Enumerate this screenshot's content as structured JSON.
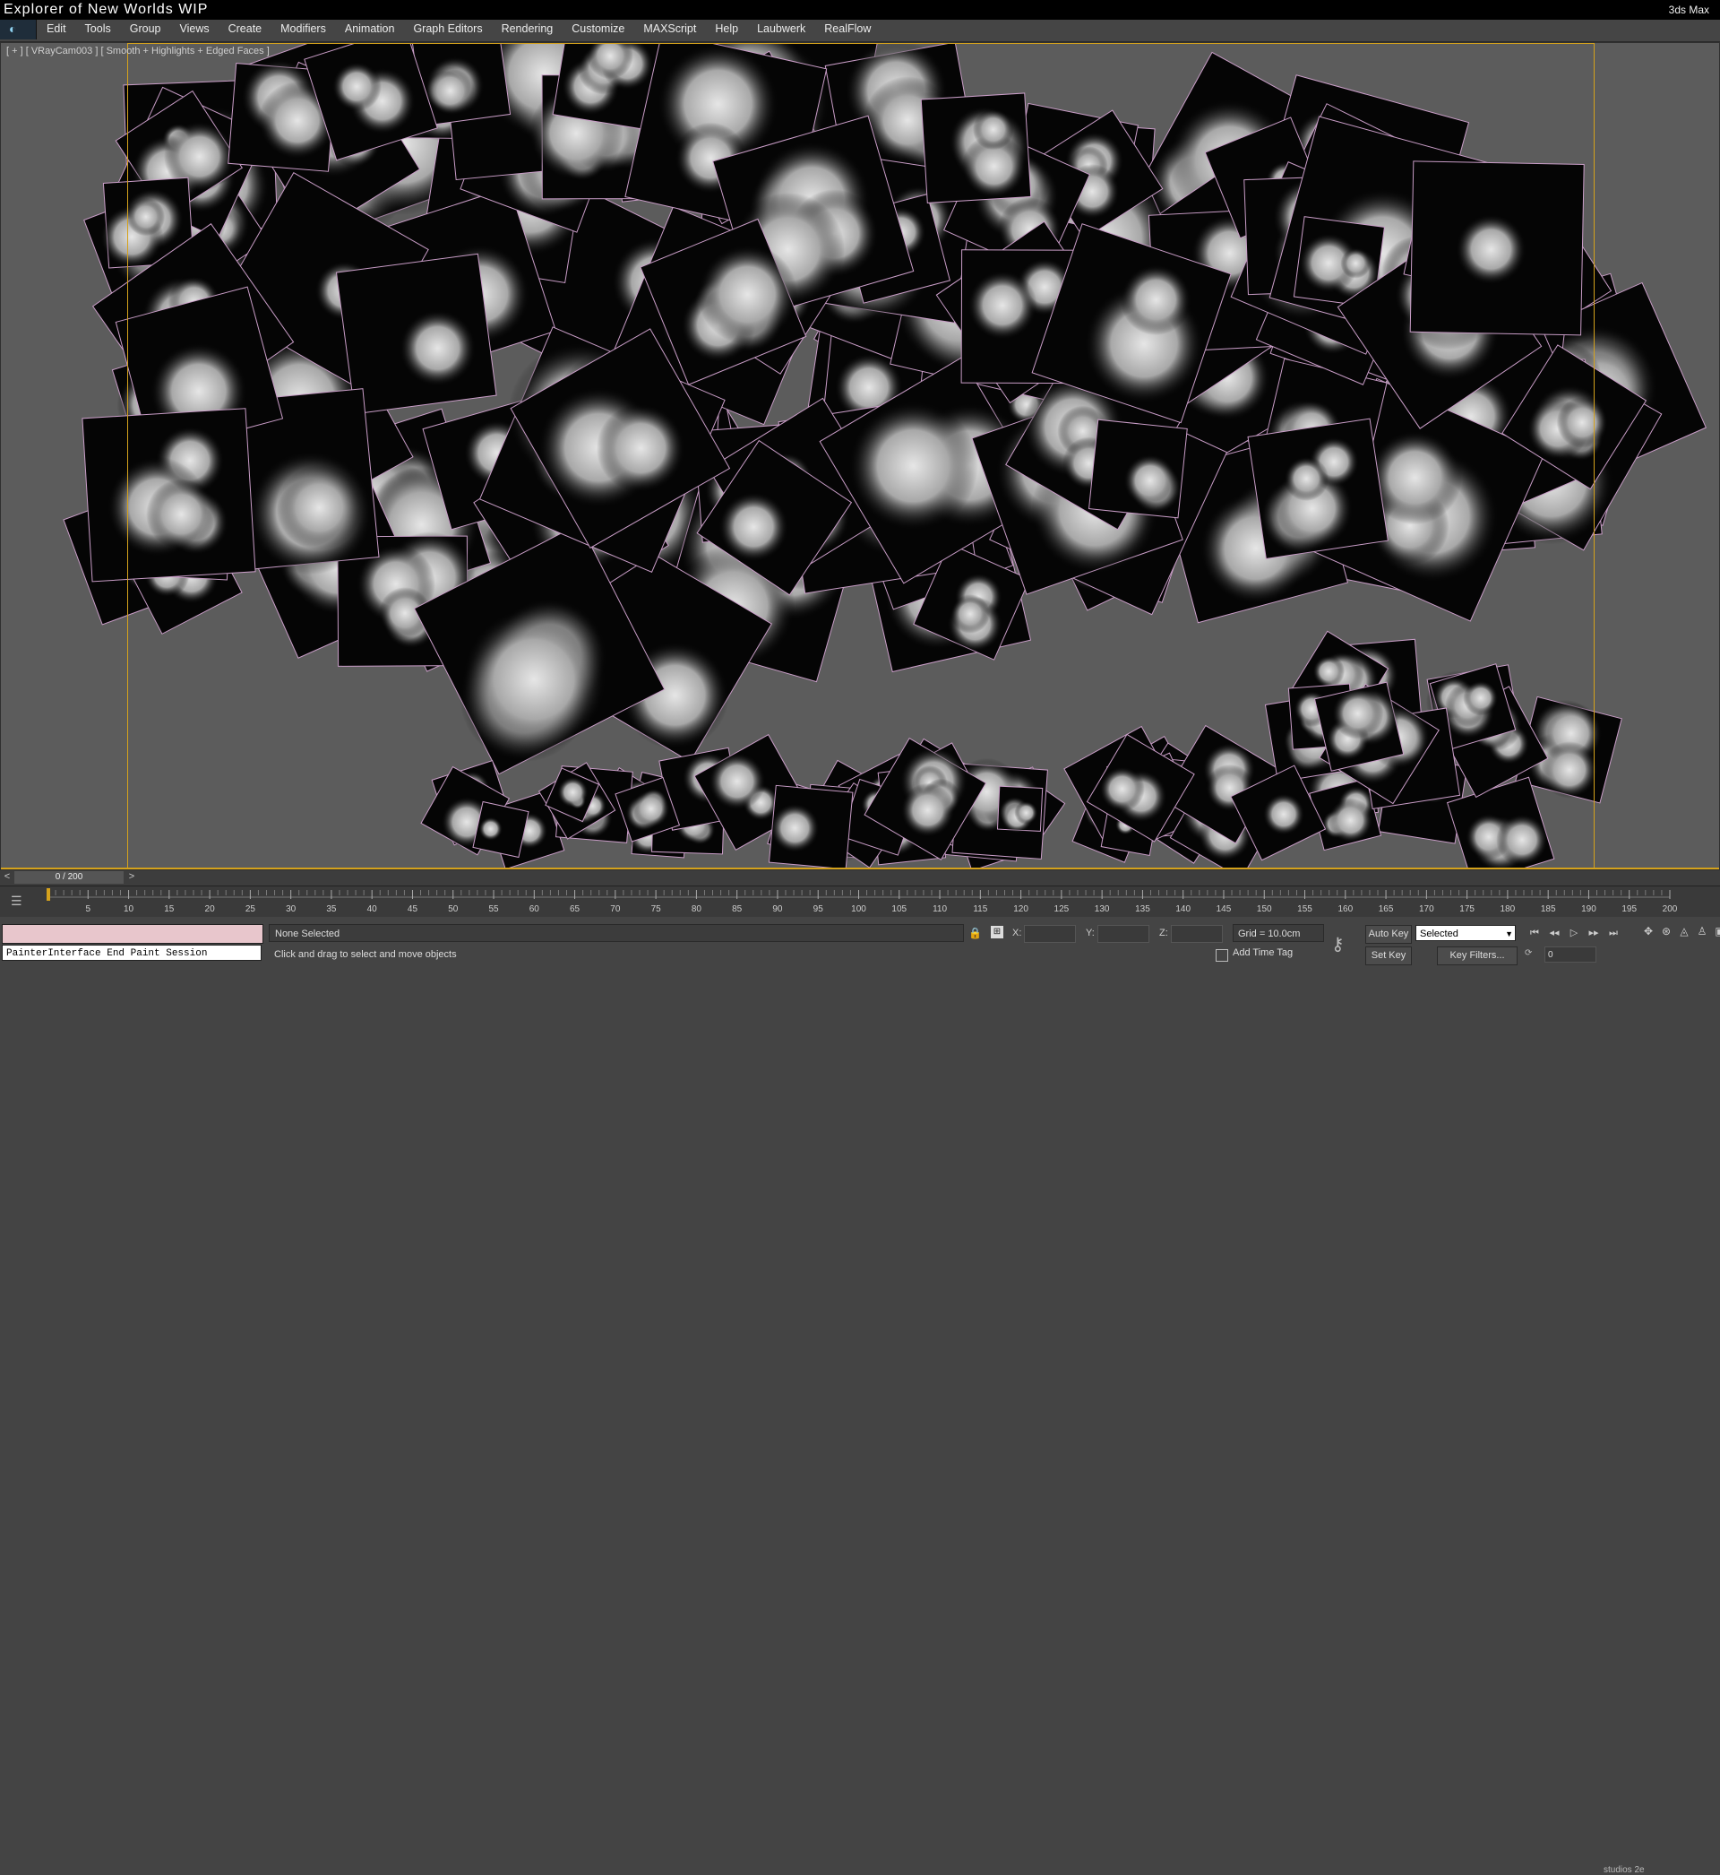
{
  "window": {
    "title": "Explorer of New Worlds WIP",
    "app_name": "3ds Max"
  },
  "menu": [
    "Edit",
    "Tools",
    "Group",
    "Views",
    "Create",
    "Modifiers",
    "Animation",
    "Graph Editors",
    "Rendering",
    "Customize",
    "MAXScript",
    "Help",
    "Laubwerk",
    "RealFlow"
  ],
  "viewport": {
    "label": "[ + ] [ VRayCam003 ] [ Smooth + Highlights + Edged Faces ]"
  },
  "time_slider": {
    "frame_display": "0 / 200",
    "prev": "<",
    "next": ">"
  },
  "timeline": {
    "start": 0,
    "end": 200,
    "major_step": 5,
    "current": 0
  },
  "status": {
    "maxscript_output": "PainterInterface End Paint Session",
    "selection": "None Selected",
    "prompt": "Click and drag to select and move objects",
    "coords": {
      "x_label": "X:",
      "y_label": "Y:",
      "z_label": "Z:"
    },
    "grid": "Grid = 10.0cm",
    "add_time_tag": "Add Time Tag"
  },
  "animation_controls": {
    "auto_key": "Auto Key",
    "set_key": "Set Key",
    "key_mode_selected": "Selected",
    "key_filters": "Key Filters...",
    "current_frame": "0"
  },
  "watermark": "studios 2e"
}
